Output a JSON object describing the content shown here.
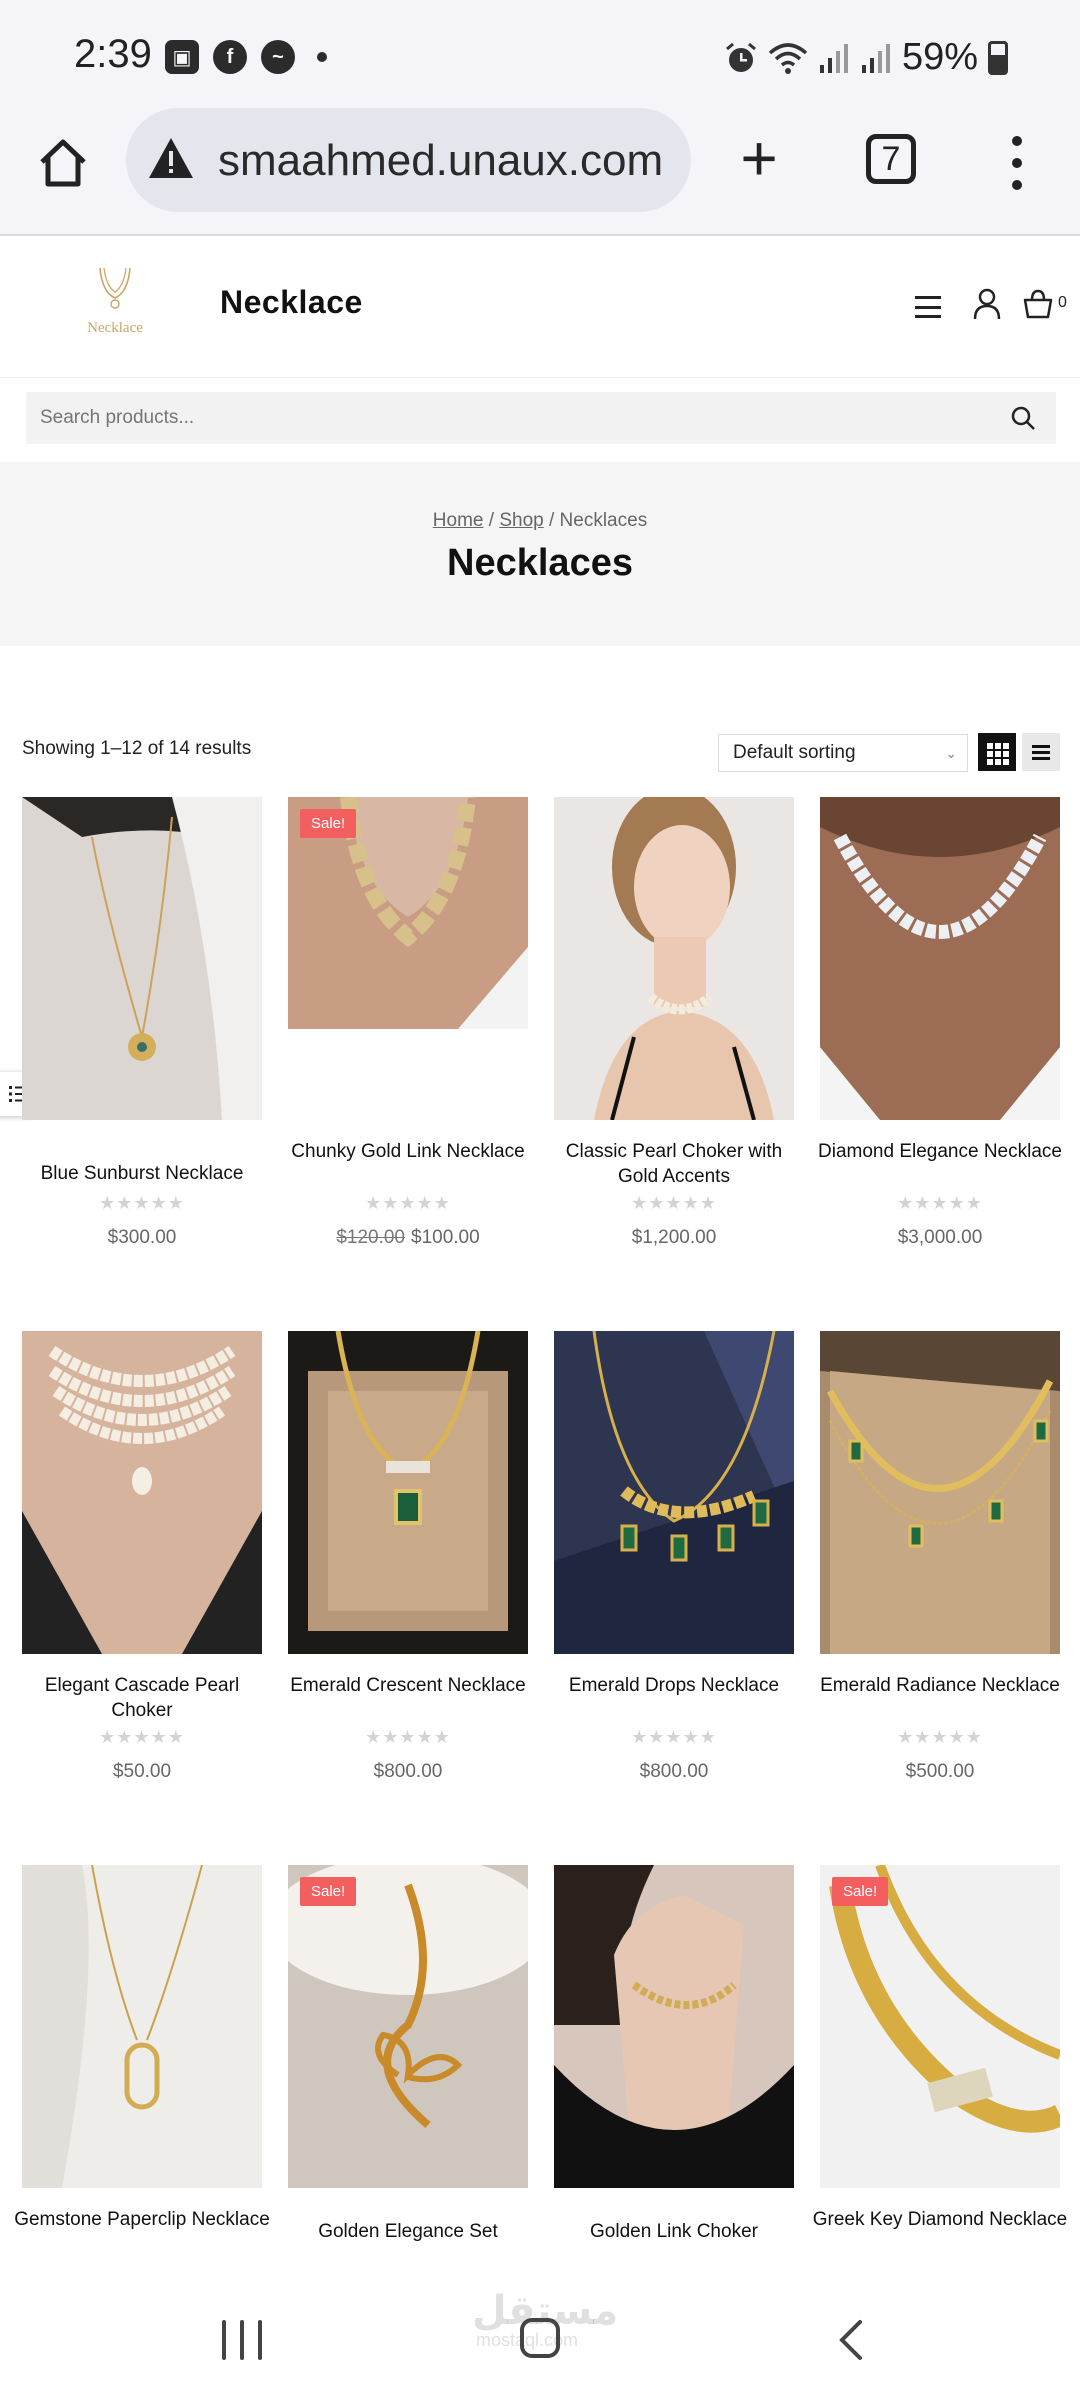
{
  "status_bar": {
    "time": "2:39",
    "battery": "59%",
    "battery_level": 0.59
  },
  "browser": {
    "url": "smaahmed.unaux.com",
    "tab_count": "7"
  },
  "site": {
    "logo_text": "Necklace",
    "title": "Necklace",
    "cart_count": "0"
  },
  "search": {
    "placeholder": "Search products..."
  },
  "breadcrumb": {
    "home": "Home",
    "sep1": " / ",
    "shop": "Shop",
    "sep2": " / ",
    "current": "Necklaces"
  },
  "page_title": "Necklaces",
  "toolbar": {
    "result_count": "Showing 1–12 of 14 results",
    "sorting": "Default sorting"
  },
  "products": [
    {
      "name": "Blue Sunburst Necklace",
      "price": "$300.00",
      "old_price": "",
      "sale": "",
      "rating": 0
    },
    {
      "name": "Chunky Gold Link Necklace",
      "price": "$100.00",
      "old_price": "$120.00",
      "sale": "Sale!",
      "rating": 0
    },
    {
      "name": "Classic Pearl Choker with Gold Accents",
      "price": "$1,200.00",
      "old_price": "",
      "sale": "",
      "rating": 0
    },
    {
      "name": "Diamond Elegance Necklace",
      "price": "$3,000.00",
      "old_price": "",
      "sale": "",
      "rating": 0
    },
    {
      "name": "Elegant Cascade Pearl Choker",
      "price": "$50.00",
      "old_price": "",
      "sale": "",
      "rating": 0
    },
    {
      "name": "Emerald Crescent Necklace",
      "price": "$800.00",
      "old_price": "",
      "sale": "",
      "rating": 0
    },
    {
      "name": "Emerald Drops Necklace",
      "price": "$800.00",
      "old_price": "",
      "sale": "",
      "rating": 0
    },
    {
      "name": "Emerald Radiance Necklace",
      "price": "$500.00",
      "old_price": "",
      "sale": "",
      "rating": 0
    },
    {
      "name": "Gemstone Paperclip Necklace",
      "price": "",
      "old_price": "",
      "sale": "",
      "rating": 0
    },
    {
      "name": "Golden Elegance Set",
      "price": "",
      "old_price": "",
      "sale": "Sale!",
      "rating": 0
    },
    {
      "name": "Golden Link Choker",
      "price": "",
      "old_price": "",
      "sale": "",
      "rating": 0
    },
    {
      "name": "Greek Key Diamond Necklace",
      "price": "",
      "old_price": "",
      "sale": "Sale!",
      "rating": 0
    }
  ],
  "watermark": {
    "text": "مستقل",
    "sub": "mostaql.com"
  },
  "colors": {
    "sale": "#f35f5f",
    "accent": "#111111",
    "hero_bg": "#f5f5f5",
    "gold": "#caa565"
  }
}
